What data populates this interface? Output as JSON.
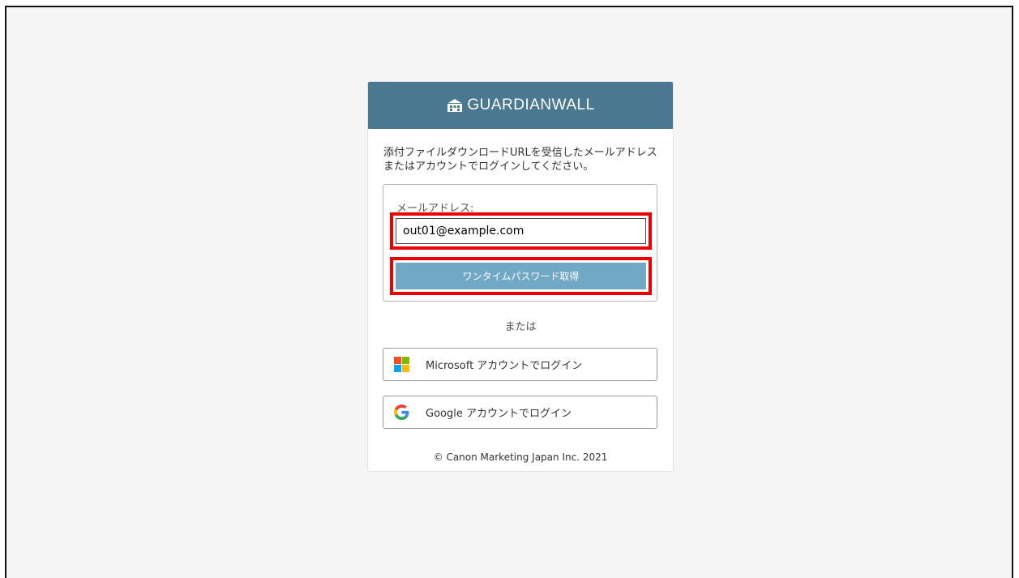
{
  "brand": {
    "name": "GUARDIANWALL",
    "header_color": "#4a7891"
  },
  "intro": {
    "text": "添付ファイルダウンロードURLを受信したメールアドレスまたはアカウントでログインしてください。"
  },
  "login": {
    "email_label": "メールアドレス:",
    "email_value": "out01@example.com",
    "otp_button_label": "ワンタイムパスワード取得",
    "button_color": "#71a8c6",
    "highlight_color": "#ee0000"
  },
  "or_text": "または",
  "sso": {
    "microsoft_label": "Microsoft アカウントでログイン",
    "microsoft_icon": "microsoft-logo-icon",
    "google_label": "Google アカウントでログイン",
    "google_icon": "google-logo-icon"
  },
  "footer": {
    "copyright": "© Canon Marketing Japan Inc. 2021"
  }
}
